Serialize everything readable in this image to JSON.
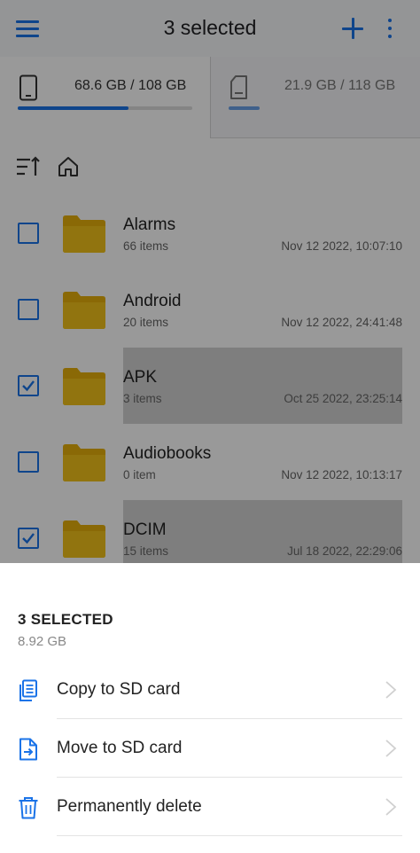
{
  "colors": {
    "accent": "#1a73e8",
    "folder": "#e6b00a",
    "scrim": "rgba(0,0,0,0.40)"
  },
  "header": {
    "title": "3 selected",
    "icons": [
      "menu-icon",
      "add-icon",
      "more-vert-icon"
    ]
  },
  "storage": {
    "internal": {
      "label": "68.6 GB / 108 GB",
      "used_fraction": 0.635,
      "icon": "phone-icon"
    },
    "sd": {
      "label": "21.9 GB / 118 GB",
      "used_fraction": 0.18,
      "icon": "sd-card-icon"
    }
  },
  "pathbar": {
    "icons": [
      "sort-icon",
      "home-icon"
    ]
  },
  "files": [
    {
      "name": "Alarms",
      "count": "66 items",
      "date": "Nov 12 2022, 10:07:10",
      "selected": false
    },
    {
      "name": "Android",
      "count": "20 items",
      "date": "Nov 12 2022, 24:41:48",
      "selected": false
    },
    {
      "name": "APK",
      "count": "3 items",
      "date": "Oct 25 2022, 23:25:14",
      "selected": true
    },
    {
      "name": "Audiobooks",
      "count": "0 item",
      "date": "Nov 12 2022, 10:13:17",
      "selected": false
    },
    {
      "name": "DCIM",
      "count": "15 items",
      "date": "Jul 18 2022, 22:29:06",
      "selected": true
    }
  ],
  "sheet": {
    "title": "3 SELECTED",
    "size": "8.92 GB",
    "actions": [
      {
        "label": "Copy to SD card",
        "icon": "copy-icon"
      },
      {
        "label": "Move to SD card",
        "icon": "move-file-icon"
      },
      {
        "label": "Permanently delete",
        "icon": "trash-icon"
      }
    ]
  }
}
